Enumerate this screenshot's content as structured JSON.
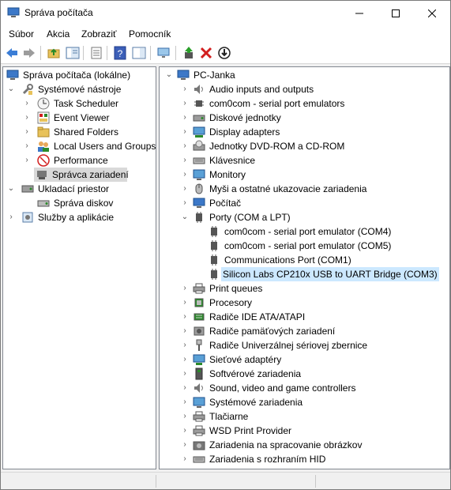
{
  "window": {
    "title": "Správa počítača"
  },
  "menu": [
    "Súbor",
    "Akcia",
    "Zobraziť",
    "Pomocník"
  ],
  "toolbar_icons": [
    "back-icon",
    "forward-icon",
    "up-folder-icon",
    "show-hide-tree-icon",
    "properties-icon",
    "help-icon",
    "action-pane-icon",
    "monitor-icon",
    "update-driver-icon",
    "uninstall-icon",
    "disable-icon"
  ],
  "left_tree": [
    {
      "label": "Správa počítača (lokálne)",
      "icon": "computer-management-icon",
      "arrow": ""
    },
    {
      "label": "Systémové nástroje",
      "icon": "tools-icon",
      "arrow": "⌄"
    },
    {
      "label": "Task Scheduler",
      "icon": "clock-icon",
      "arrow": "›"
    },
    {
      "label": "Event Viewer",
      "icon": "event-viewer-icon",
      "arrow": "›"
    },
    {
      "label": "Shared Folders",
      "icon": "shared-folder-icon",
      "arrow": "›"
    },
    {
      "label": "Local Users and Groups",
      "icon": "users-icon",
      "arrow": "›"
    },
    {
      "label": "Performance",
      "icon": "performance-icon",
      "arrow": "›"
    },
    {
      "label": "Správca zariadení",
      "icon": "device-manager-icon",
      "arrow": ""
    },
    {
      "label": "Ukladací priestor",
      "icon": "storage-icon",
      "arrow": "⌄"
    },
    {
      "label": "Správa diskov",
      "icon": "disk-management-icon",
      "arrow": ""
    },
    {
      "label": "Služby a aplikácie",
      "icon": "services-icon",
      "arrow": "›"
    }
  ],
  "right_tree": [
    {
      "label": "PC-Janka",
      "icon": "computer-icon",
      "arrow": "⌄"
    },
    {
      "label": "Audio inputs and outputs",
      "icon": "speaker-icon",
      "arrow": "›"
    },
    {
      "label": "com0com - serial port emulators",
      "icon": "chip-icon",
      "arrow": "›"
    },
    {
      "label": "Diskové jednotky",
      "icon": "disk-icon",
      "arrow": "›"
    },
    {
      "label": "Display adapters",
      "icon": "display-adapter-icon",
      "arrow": "›"
    },
    {
      "label": "Jednotky DVD-ROM a CD-ROM",
      "icon": "dvd-icon",
      "arrow": "›"
    },
    {
      "label": "Klávesnice",
      "icon": "keyboard-icon",
      "arrow": "›"
    },
    {
      "label": "Monitory",
      "icon": "monitor-icon",
      "arrow": "›"
    },
    {
      "label": "Myši a ostatné ukazovacie zariadenia",
      "icon": "mouse-icon",
      "arrow": "›"
    },
    {
      "label": "Počítač",
      "icon": "computer-icon",
      "arrow": "›"
    },
    {
      "label": "Porty (COM a LPT)",
      "icon": "port-icon",
      "arrow": "⌄"
    },
    {
      "label": "com0com - serial port emulator (COM4)",
      "icon": "port-icon",
      "arrow": ""
    },
    {
      "label": "com0com - serial port emulator (COM5)",
      "icon": "port-icon",
      "arrow": ""
    },
    {
      "label": "Communications Port (COM1)",
      "icon": "port-icon",
      "arrow": ""
    },
    {
      "label": "Silicon Labs CP210x USB to UART Bridge (COM3)",
      "icon": "port-icon",
      "arrow": ""
    },
    {
      "label": "Print queues",
      "icon": "printer-icon",
      "arrow": "›"
    },
    {
      "label": "Procesory",
      "icon": "processor-icon",
      "arrow": "›"
    },
    {
      "label": "Radiče IDE ATA/ATAPI",
      "icon": "ide-icon",
      "arrow": "›"
    },
    {
      "label": "Radiče pamäťových zariadení",
      "icon": "storage-controller-icon",
      "arrow": "›"
    },
    {
      "label": "Radiče Univerzálnej sériovej zbernice",
      "icon": "usb-icon",
      "arrow": "›"
    },
    {
      "label": "Sieťové adaptéry",
      "icon": "network-icon",
      "arrow": "›"
    },
    {
      "label": "Softvérové zariadenia",
      "icon": "software-device-icon",
      "arrow": "›"
    },
    {
      "label": "Sound, video and game controllers",
      "icon": "sound-icon",
      "arrow": "›"
    },
    {
      "label": "Systémové zariadenia",
      "icon": "system-device-icon",
      "arrow": "›"
    },
    {
      "label": "Tlačiarne",
      "icon": "printer-icon",
      "arrow": "›"
    },
    {
      "label": "WSD Print Provider",
      "icon": "printer-icon",
      "arrow": "›"
    },
    {
      "label": "Zariadenia na spracovanie obrázkov",
      "icon": "camera-icon",
      "arrow": "›"
    },
    {
      "label": "Zariadenia s rozhraním HID",
      "icon": "hid-icon",
      "arrow": "›"
    }
  ]
}
